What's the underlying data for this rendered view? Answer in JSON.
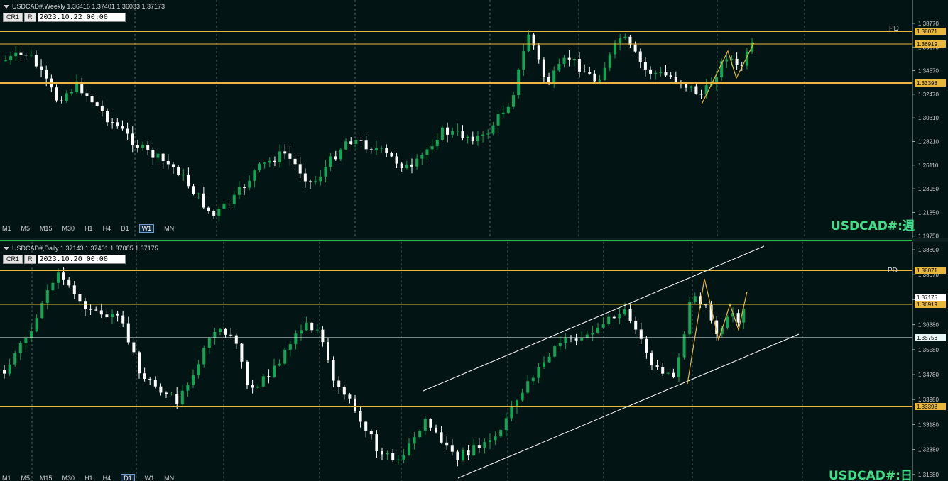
{
  "top": {
    "header": "USDCAD#,Weekly  1.36416 1.37401 1.36033 1.37173",
    "btn_cr": "CR1",
    "btn_r": "R",
    "date": "2023.10.22 00:00",
    "symbol_label": "USDCAD#:週",
    "pd_label": "PD",
    "timeframes": [
      "M1",
      "M5",
      "M15",
      "M30",
      "H1",
      "H4",
      "D1",
      "W1",
      "MN"
    ],
    "active_tf": "W1",
    "y_ticks": [
      "1.38770",
      "1.36670",
      "1.34570",
      "1.32470",
      "1.30310",
      "1.28210",
      "1.26110",
      "1.23950",
      "1.21850",
      "1.19750"
    ],
    "levels": [
      {
        "value": "1.38071",
        "style": "thick"
      },
      {
        "value": "1.36919",
        "style": "thin"
      },
      {
        "value": "1.33398",
        "style": "thick"
      }
    ],
    "colors": {
      "bg": "#031414",
      "bull": "#11a653",
      "bear": "#ffffff",
      "level": "#e8b83c",
      "zigzag": "#e8b83c"
    }
  },
  "bottom": {
    "header": "USDCAD#,Daily  1.37143 1.37401 1.37085 1.37175",
    "btn_cr": "CR1",
    "btn_r": "R",
    "date": "2023.10.20 00:00",
    "symbol_label": "USDCAD#:日",
    "pd_label": "PD",
    "timeframes": [
      "M1",
      "M5",
      "M15",
      "M30",
      "H1",
      "H4",
      "D1",
      "W1",
      "MN"
    ],
    "active_tf": "D1",
    "y_ticks": [
      "1.38800",
      "1.38070",
      "1.37175",
      "1.36380",
      "1.35580",
      "1.34780",
      "1.33980",
      "1.33180",
      "1.32380",
      "1.31580"
    ],
    "levels": [
      {
        "value": "1.38071",
        "style": "thick"
      },
      {
        "value": "1.36919",
        "style": "thin"
      },
      {
        "value": "1.35756",
        "style": "white"
      },
      {
        "value": "1.33398",
        "style": "thick"
      }
    ],
    "current_price": "1.37175",
    "colors": {
      "bg": "#031414",
      "bull": "#11a653",
      "bear": "#ffffff",
      "level": "#e8b83c",
      "channel": "#ffffff"
    }
  }
}
